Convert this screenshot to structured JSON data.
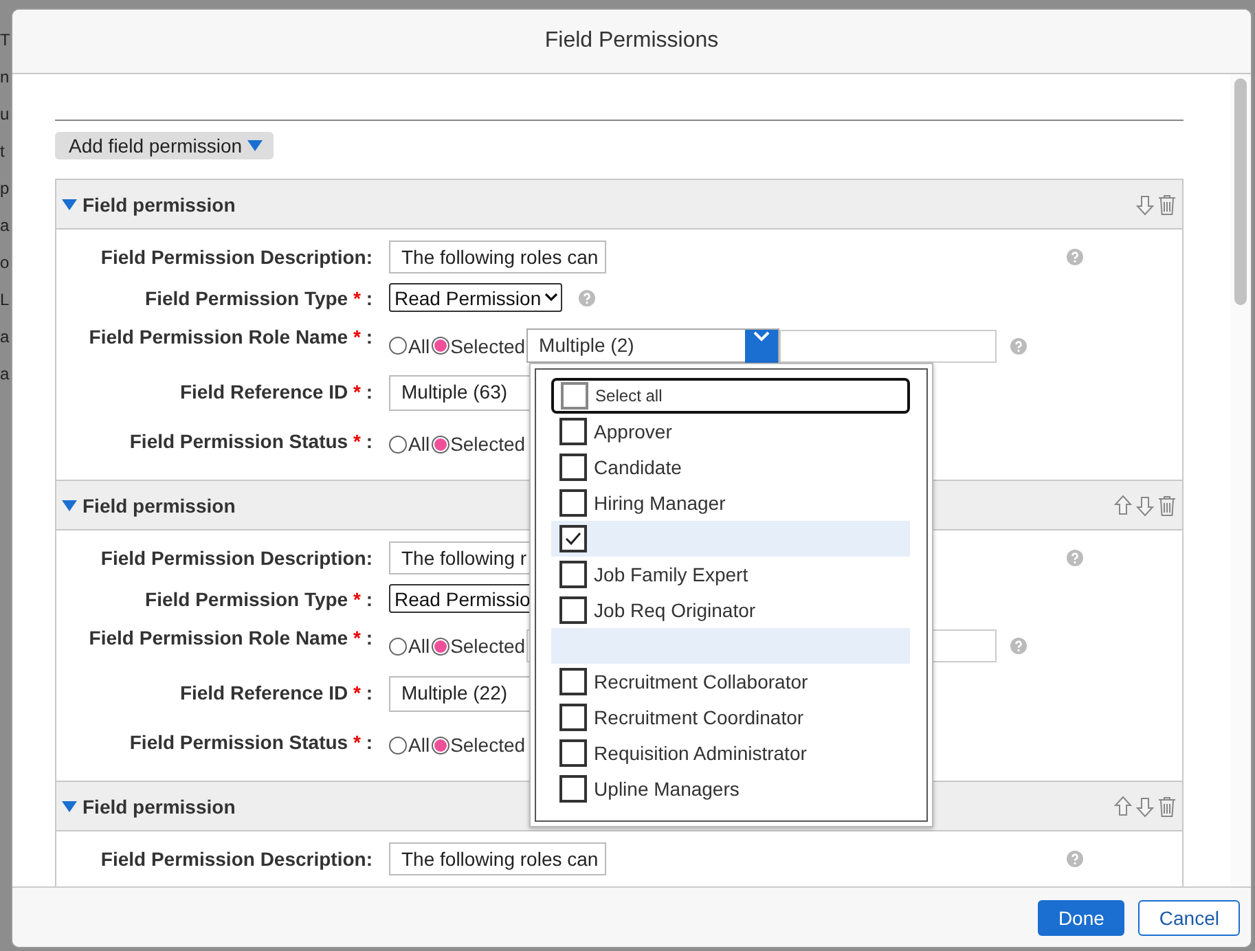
{
  "background_fragments": [
    "T",
    "n",
    "u",
    "t",
    "p",
    "a",
    "o",
    "L",
    "a",
    "a"
  ],
  "dialog": {
    "title": "Field Permissions",
    "add_button": "Add field permission",
    "sections": [
      {
        "title": "Field permission",
        "expanded": true,
        "can_move_up": false,
        "required_mark": "*",
        "label_suffix": ":",
        "description_label": "Field Permission Description:",
        "description": "The following roles can",
        "type_label": "Field Permission Type",
        "type_value": "Read Permission",
        "type_help": true,
        "role_label": "Field Permission Role Name",
        "role_all": "All",
        "role_selected": "Selected",
        "role_all_selected": false,
        "role_select": {
          "value": "Multiple (2)",
          "open": true
        },
        "ref_label": "Field Reference ID",
        "ref_value": "Multiple (63)",
        "status_label": "Field Permission Status",
        "status_all": "All",
        "status_selected": "Selected",
        "status_all_selected": false
      },
      {
        "title": "Field permission",
        "expanded": true,
        "can_move_up": true,
        "required_mark": "*",
        "label_suffix": ":",
        "description_label": "Field Permission Description:",
        "description": "The following r",
        "type_label": "Field Permission Type",
        "type_value": "Read Permissio",
        "type_help": false,
        "role_label": "Field Permission Role Name",
        "role_all": "All",
        "role_selected": "Selected",
        "role_all_selected": false,
        "ref_label": "Field Reference ID",
        "ref_value": "Multiple (22)",
        "status_label": "Field Permission Status",
        "status_all": "All",
        "status_selected": "Selected",
        "status_all_selected": false
      },
      {
        "title": "Field permission",
        "expanded": true,
        "can_move_up": true,
        "description_label": "Field Permission Description:",
        "description": "The following roles can"
      }
    ],
    "dropdown": {
      "select_all": {
        "label": "Select all",
        "checked": false,
        "focused": true
      },
      "options": [
        {
          "kind": "checkbox",
          "label": "Approver",
          "checked": false,
          "highlighted": false
        },
        {
          "kind": "checkbox",
          "label": "Candidate",
          "checked": false,
          "highlighted": false
        },
        {
          "kind": "checkbox",
          "label": "Hiring Manager",
          "checked": false,
          "highlighted": false
        },
        {
          "kind": "checkbox",
          "checked": true,
          "highlighted": true
        },
        {
          "kind": "checkbox",
          "label": "Job Family Expert",
          "checked": false,
          "highlighted": false
        },
        {
          "kind": "checkbox",
          "label": "Job Req Originator",
          "checked": false,
          "highlighted": false
        },
        {
          "kind": "blank",
          "highlighted": true
        },
        {
          "kind": "checkbox",
          "label": "Recruitment Collaborator",
          "checked": false,
          "highlighted": false
        },
        {
          "kind": "checkbox",
          "label": "Recruitment Coordinator",
          "checked": false,
          "highlighted": false
        },
        {
          "kind": "checkbox",
          "label": "Requisition Administrator",
          "checked": false,
          "highlighted": false
        },
        {
          "kind": "checkbox",
          "label": "Upline Managers",
          "checked": false,
          "highlighted": false
        }
      ]
    },
    "footer": {
      "done": "Done",
      "cancel": "Cancel"
    }
  }
}
